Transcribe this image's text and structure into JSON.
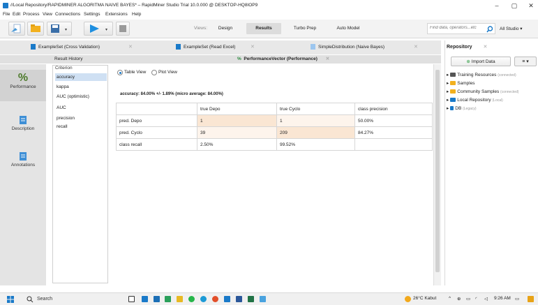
{
  "window": {
    "title": "//Local Repository/RAPIDMINER ALGORITMA NAIVE BAYES* – RapidMiner Studio Trial 10.0.000 @ DESKTOP-HQ8IOP9"
  },
  "menu": [
    "File",
    "Edit",
    "Process",
    "View",
    "Connections",
    "Settings",
    "Extensions",
    "Help"
  ],
  "views": {
    "label": "Views:",
    "tabs": [
      "Design",
      "Results",
      "Turbo Prep",
      "Auto Model"
    ],
    "active": "Results"
  },
  "search": {
    "placeholder": "Find data, operators...etc"
  },
  "studio_dropdown": "All Studio ▾",
  "doc_tabs": [
    {
      "label": "ExampleSet (Cross Validation)"
    },
    {
      "label": "ExampleSet (Read Excel)"
    },
    {
      "label": "SimpleDistribution (Naive Bayes)"
    }
  ],
  "inner_tabs": {
    "result_history": "Result History",
    "performance_vector": "PerformanceVector (Performance)"
  },
  "left_nav": [
    "Performance",
    "Description",
    "Annotations"
  ],
  "criterion": {
    "legend": "Criterion",
    "items": [
      "accuracy",
      "kappa",
      "AUC (optimistic)",
      "AUC",
      "precision",
      "recall"
    ],
    "selected": "accuracy"
  },
  "view_mode": {
    "table": "Table View",
    "plot": "Plot View"
  },
  "accuracy_text": "accuracy: 84.00% +/- 1.89% (micro average: 84.00%)",
  "table": {
    "headers": [
      "",
      "true Depo",
      "true Cyclo",
      "class precision"
    ],
    "rows": [
      [
        "pred. Depo",
        "1",
        "1",
        "50.00%"
      ],
      [
        "pred. Cyclo",
        "39",
        "209",
        "84.27%"
      ],
      [
        "class recall",
        "2.50%",
        "99.52%",
        ""
      ]
    ]
  },
  "repository": {
    "title": "Repository",
    "import_label": "Import Data",
    "menu_label": "≡ ▾",
    "items": [
      {
        "label": "Training Resources",
        "sub": "(connected)",
        "color": "#555555"
      },
      {
        "label": "Samples",
        "sub": "",
        "color": "#f2b01e"
      },
      {
        "label": "Community Samples",
        "sub": "(connected)",
        "color": "#f2b01e"
      },
      {
        "label": "Local Repository",
        "sub": "(Local)",
        "color": "#1a7ac9"
      },
      {
        "label": "DB",
        "sub": "(Legacy)",
        "color": "#1a7ac9"
      }
    ]
  },
  "taskbar": {
    "search": "Search",
    "weather": "26°C  Kabut",
    "time": "9:26 AM"
  }
}
